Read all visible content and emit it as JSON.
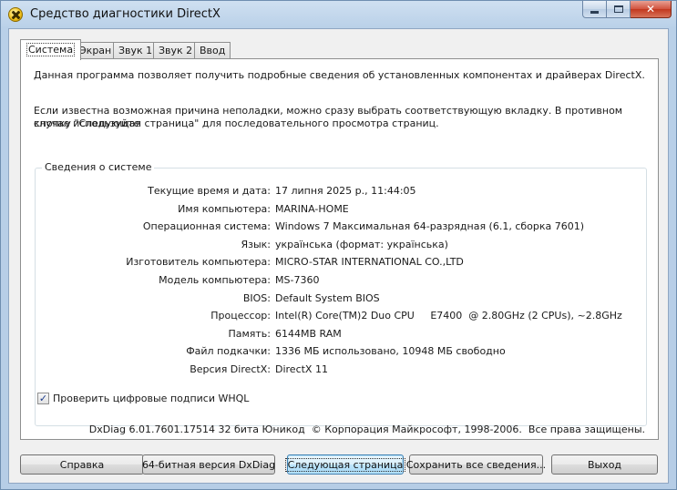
{
  "window": {
    "title": "Средство диагностики DirectX",
    "min_label": "",
    "max_label": "",
    "close_label": "✕"
  },
  "tabs": [
    {
      "label": "Система",
      "active": true
    },
    {
      "label": "Экран",
      "active": false
    },
    {
      "label": "Звук 1",
      "active": false
    },
    {
      "label": "Звук 2",
      "active": false
    },
    {
      "label": "Ввод",
      "active": false
    }
  ],
  "panel": {
    "intro": "Данная программа позволяет получить подробные сведения об установленных компонентах и драйверах DirectX.",
    "hint_line1": "Если известна возможная причина неполадки, можно сразу выбрать соответствующую вкладку. В противном случае используйте",
    "hint_line2": "кнопку \"Следующая страница\" для последовательного просмотра страниц."
  },
  "system_info": {
    "title": "Сведения о системе",
    "rows": [
      {
        "label": "Текущие время и дата:",
        "value": "17 липня 2025 р., 11:44:05"
      },
      {
        "label": "Имя компьютера:",
        "value": "MARINA-HOME"
      },
      {
        "label": "Операционная система:",
        "value": "Windows 7 Максимальная 64-разрядная (6.1, сборка 7601)"
      },
      {
        "label": "Язык:",
        "value": "українська (формат: українська)"
      },
      {
        "label": "Изготовитель компьютера:",
        "value": "MICRO-STAR INTERNATIONAL CO.,LTD"
      },
      {
        "label": "Модель компьютера:",
        "value": "MS-7360"
      },
      {
        "label": "BIOS:",
        "value": "Default System BIOS"
      },
      {
        "label": "Процессор:",
        "value": "Intel(R) Core(TM)2 Duo CPU     E7400  @ 2.80GHz (2 CPUs), ~2.8GHz"
      },
      {
        "label": "Память:",
        "value": "6144MB RAM"
      },
      {
        "label": "Файл подкачки:",
        "value": "1336 МБ использовано, 10948 МБ свободно"
      },
      {
        "label": "Версия DirectX:",
        "value": "DirectX 11"
      }
    ]
  },
  "whql": {
    "label": "Проверить цифровые подписи WHQL",
    "checked": true,
    "mark": "✓"
  },
  "footer": "DxDiag 6.01.7601.17514 32 бита Юникод  © Корпорация Майкрософт, 1998-2006.  Все права защищены.",
  "buttons": {
    "help": "Справка",
    "dxdiag64": "64-битная версия DxDiag",
    "next_page": "Следующая страница",
    "save_all": "Сохранить все сведения...",
    "exit": "Выход"
  }
}
